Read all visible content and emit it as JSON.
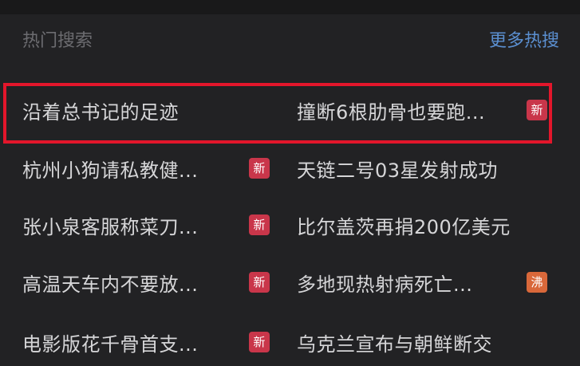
{
  "header": {
    "title": "热门搜索",
    "more_label": "更多热搜"
  },
  "hot_searches": {
    "left": [
      {
        "text": "沿着总书记的足迹",
        "badge": ""
      },
      {
        "text": "杭州小狗请私教健...",
        "badge": "新"
      },
      {
        "text": "张小泉客服称菜刀...",
        "badge": "新"
      },
      {
        "text": "高温天车内不要放...",
        "badge": "新"
      },
      {
        "text": "电影版花千骨首支...",
        "badge": "新"
      }
    ],
    "right": [
      {
        "text": "撞断6根肋骨也要跑...",
        "badge": "新"
      },
      {
        "text": "天链二号03星发射成功",
        "badge": ""
      },
      {
        "text": "比尔盖茨再捐200亿美元",
        "badge": ""
      },
      {
        "text": "多地现热射病死亡...",
        "badge": "沸"
      },
      {
        "text": "乌克兰宣布与朝鲜断交",
        "badge": ""
      }
    ]
  },
  "colors": {
    "background": "#222224",
    "badge_new": "#c9364a",
    "badge_hot": "#d9683a",
    "highlight_border": "#e3162b",
    "link": "#5b8fd0"
  }
}
